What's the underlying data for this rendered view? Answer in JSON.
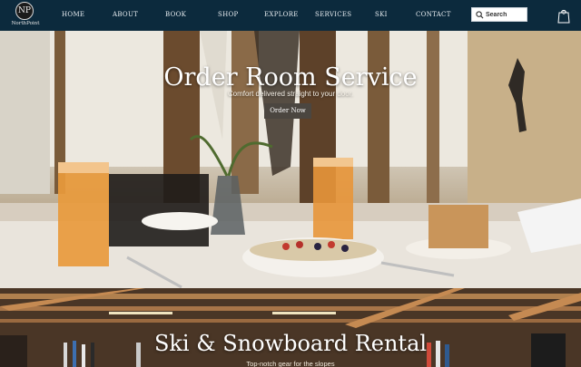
{
  "brand": {
    "initials": "NP",
    "name": "NorthPoint"
  },
  "nav": {
    "items": [
      {
        "label": "HOME"
      },
      {
        "label": "ABOUT"
      },
      {
        "label": "BOOK"
      },
      {
        "label": "SHOP"
      },
      {
        "label": "EXPLORE"
      },
      {
        "label": "SERVICES"
      },
      {
        "label": "SKI"
      },
      {
        "label": "CONTACT"
      }
    ]
  },
  "search": {
    "placeholder": "Search"
  },
  "cart": {
    "count": "0"
  },
  "hero_room_service": {
    "title": "Order Room Service",
    "subtitle": "Comfort delivered straight to your door.",
    "button_label": "Order Now"
  },
  "hero_ski_rental": {
    "title": "Ski & Snowboard Rental",
    "subtitle": "Top-notch gear for the slopes"
  },
  "colors": {
    "nav_bg": "#0c2a3d",
    "button_bg": "#4b4640",
    "text_light": "#ffffff"
  }
}
